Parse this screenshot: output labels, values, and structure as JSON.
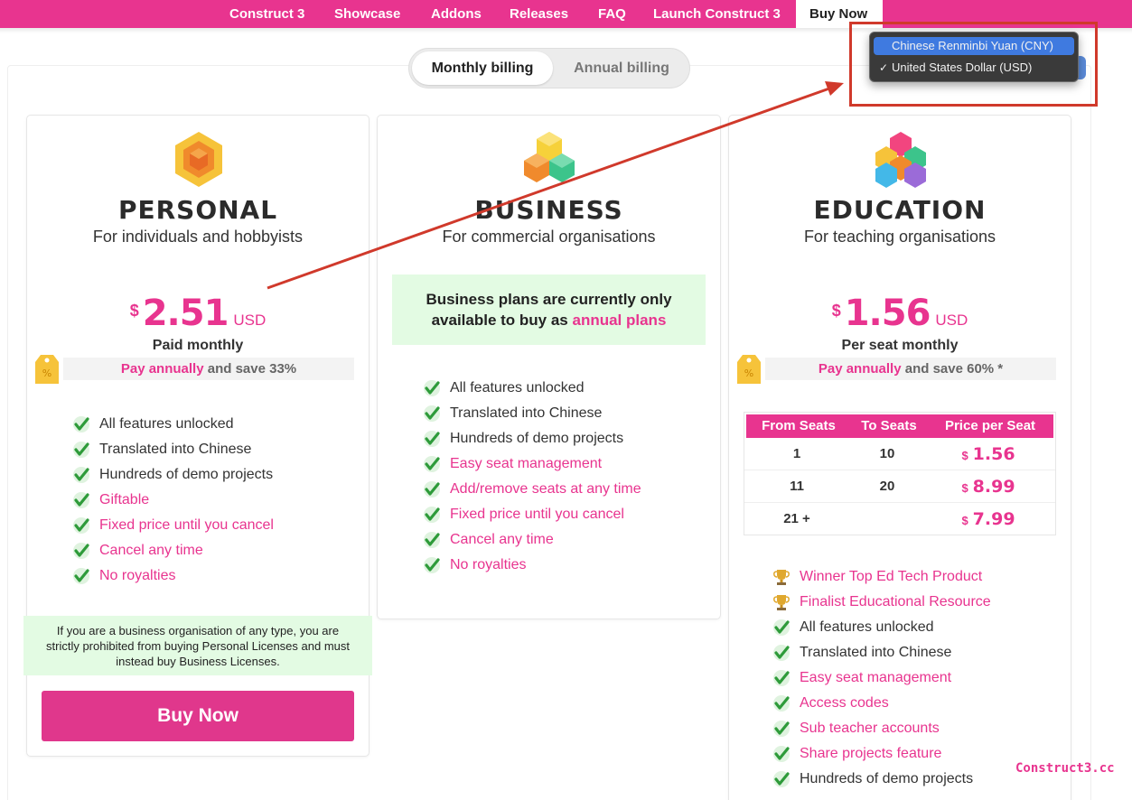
{
  "nav": {
    "items": [
      "Construct 3",
      "Showcase",
      "Addons",
      "Releases",
      "FAQ",
      "Launch Construct 3",
      "Buy Now"
    ],
    "active": "Buy Now"
  },
  "billing": {
    "monthly_label": "Monthly billing",
    "annual_label": "Annual billing",
    "selected": "Monthly billing"
  },
  "currency": {
    "options": [
      "Chinese Renminbi Yuan (CNY)",
      "United States Dollar (USD)"
    ],
    "highlighted": "Chinese Renminbi Yuan (CNY)",
    "checked": "United States Dollar (USD)",
    "check_glyph": "✓"
  },
  "personal": {
    "title": "PERSONAL",
    "subtitle": "For individuals and hobbyists",
    "currency_symbol": "$",
    "price": "2.51",
    "unit": "USD",
    "price_note": "Paid monthly",
    "save_link": "Pay annually",
    "save_text": " and save 33%",
    "features": [
      "All features unlocked",
      "Translated into Chinese",
      "Hundreds of demo projects",
      "Giftable",
      "Fixed price until you cancel",
      "Cancel any time",
      "No royalties"
    ],
    "notice": "If you are a business organisation of any type, you are strictly prohibited from buying Personal Licenses and must instead buy Business Licenses.",
    "buy_label": "Buy Now"
  },
  "business": {
    "title": "BUSINESS",
    "subtitle": "For commercial organisations",
    "notice_line1": "Business plans are currently only",
    "notice_line2": "available to buy as ",
    "notice_link": "annual plans",
    "features": [
      "All features unlocked",
      "Translated into Chinese",
      "Hundreds of demo projects",
      "Easy seat management",
      "Add/remove seats at any time",
      "Fixed price until you cancel",
      "Cancel any time",
      "No royalties"
    ]
  },
  "education": {
    "title": "EDUCATION",
    "subtitle": "For teaching organisations",
    "currency_symbol": "$",
    "price": "1.56",
    "unit": "USD",
    "price_note": "Per seat monthly",
    "save_link": "Pay annually",
    "save_text": " and save 60% *",
    "table": {
      "headers": [
        "From Seats",
        "To Seats",
        "Price per Seat"
      ],
      "rows": [
        {
          "from": "1",
          "to": "10",
          "price": "1.56"
        },
        {
          "from": "11",
          "to": "20",
          "price": "8.99"
        },
        {
          "from": "21 +",
          "to": "",
          "price": "7.99"
        }
      ],
      "currency_symbol": "$"
    },
    "awards": [
      "Winner Top Ed Tech Product",
      "Finalist Educational Resource"
    ],
    "features": [
      "All features unlocked",
      "Translated into Chinese",
      "Easy seat management",
      "Access codes",
      "Sub teacher accounts",
      "Share projects feature",
      "Hundreds of demo projects"
    ]
  },
  "watermark": "Construct3.cc",
  "colors": {
    "brand": "#e8348f",
    "check": "#2e9b3a",
    "annotation": "#d0392b",
    "highlight": "#3f7ae0"
  }
}
